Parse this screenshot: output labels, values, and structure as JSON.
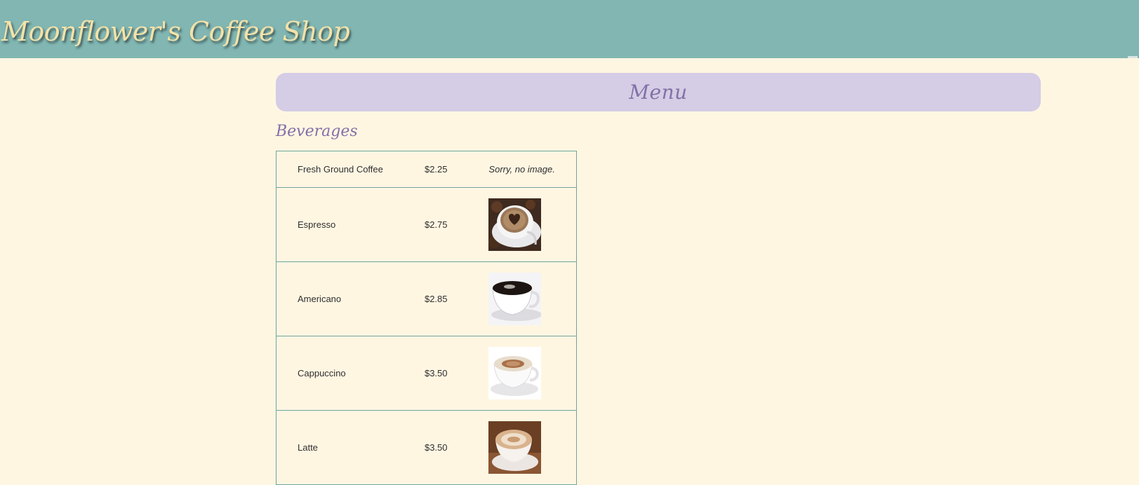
{
  "header": {
    "site_title": "Moonflower's Coffee Shop",
    "background_color": "#81b6b2"
  },
  "menu_banner": {
    "title": "Menu",
    "background_color": "#d4cde5",
    "text_color": "#8470a8"
  },
  "section": {
    "heading": "Beverages"
  },
  "items": [
    {
      "name": "Fresh Ground Coffee",
      "price": "$2.25",
      "image_note": "Sorry, no image.",
      "image": null
    },
    {
      "name": "Espresso",
      "price": "$2.75",
      "image_note": null,
      "image": "espresso-cup-image"
    },
    {
      "name": "Americano",
      "price": "$2.85",
      "image_note": null,
      "image": "americano-cup-image"
    },
    {
      "name": "Cappuccino",
      "price": "$3.50",
      "image_note": null,
      "image": "cappuccino-cup-image"
    },
    {
      "name": "Latte",
      "price": "$3.50",
      "image_note": null,
      "image": "latte-cup-image"
    }
  ]
}
